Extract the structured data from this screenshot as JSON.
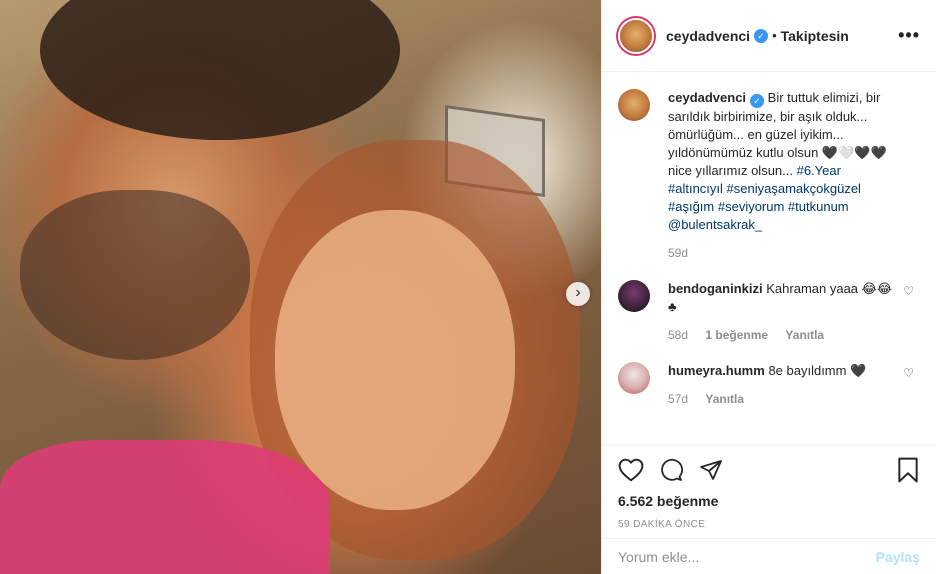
{
  "post": {
    "username": "ceydadvenci",
    "follow_status": "Takiptesin",
    "more": "•••",
    "caption_text": "Bir tuttuk elimizi, bir sarıldık birbirimize, bir aşık olduk... ömürlüğüm... en güzel iyikim... yıldönümümüz kutlu olsun 🖤🤍🖤🖤 nice yıllarımız olsun... ",
    "caption_tag1": "#6.Year",
    "caption_tags": "#altıncıyıl #seniyaşamakçokgüzel #aşığım #seviyorum #tutkunum",
    "caption_mention": "@bulentsakrak_",
    "caption_time": "59d"
  },
  "comments": [
    {
      "username": "bendoganinkizi",
      "text": "Kahraman yaaa 😂😂♣",
      "time": "58d",
      "likes": "1 beğenme",
      "reply": "Yanıtla"
    },
    {
      "username": "humeyra.humm",
      "text": "8e bayıldımm 🖤",
      "time": "57d",
      "reply": "Yanıtla"
    }
  ],
  "actions": {
    "likes": "6.562 beğenme",
    "timestamp": "59 DAKİKA ÖNCE"
  },
  "add_comment": {
    "placeholder": "Yorum ekle...",
    "share": "Paylaş"
  },
  "colors": {
    "link": "#00376b",
    "verified": "#3897f0",
    "share_disabled": "#b2dffc"
  }
}
